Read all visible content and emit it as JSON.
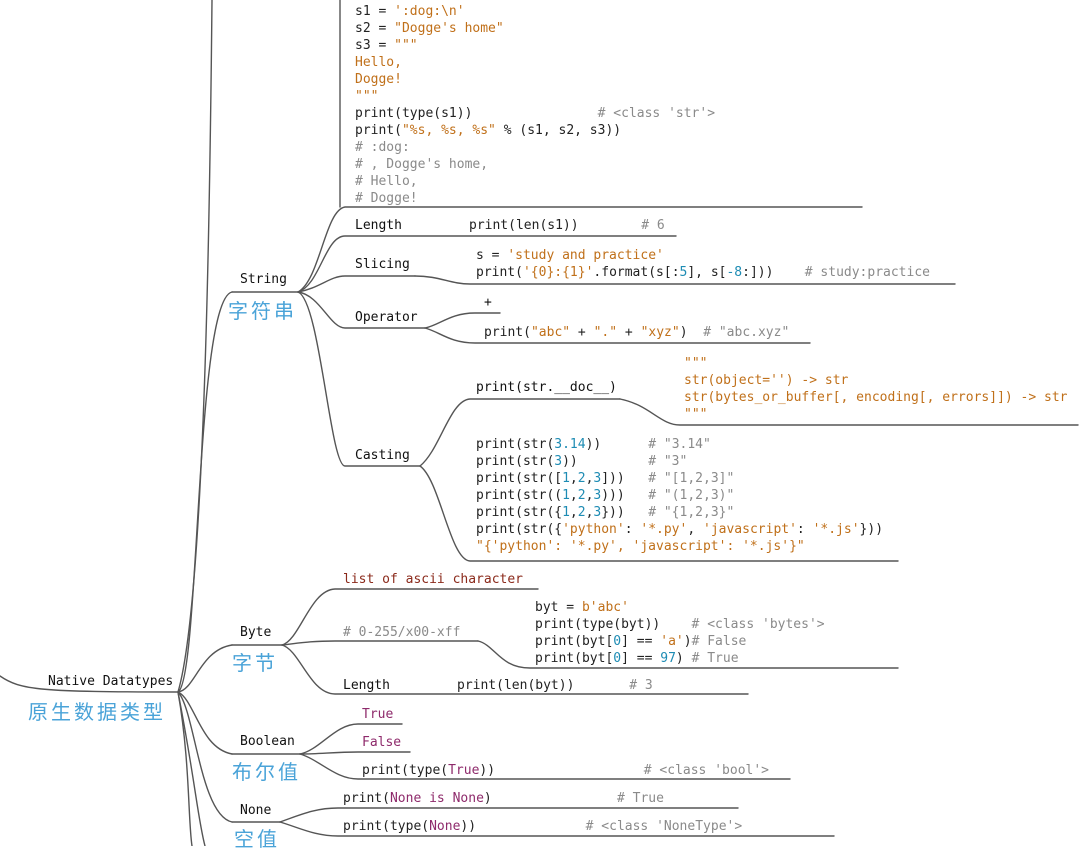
{
  "root": {
    "label": "Native Datatypes",
    "label_cn": "原生数据类型"
  },
  "string": {
    "label": "String",
    "label_cn": "字符串",
    "code": [
      [
        [
          "s1 = ",
          ""
        ],
        [
          "':dog:\\n'",
          "s"
        ]
      ],
      [
        [
          "s2 = ",
          ""
        ],
        [
          "\"Dogge's home\"",
          "s"
        ]
      ],
      [
        [
          "s3 = ",
          ""
        ],
        [
          "\"\"\"",
          "s"
        ]
      ],
      [
        [
          "Hello,",
          "s"
        ]
      ],
      [
        [
          "Dogge!",
          "s"
        ]
      ],
      [
        [
          "\"\"\"",
          "s"
        ]
      ],
      [
        [
          "print(type(s1))                ",
          ""
        ],
        [
          "# <class 'str'>",
          "c"
        ]
      ],
      [
        [
          "print(",
          ""
        ],
        [
          "\"%s, %s, %s\"",
          "s"
        ],
        [
          " % (s1, s2, s3))",
          ""
        ]
      ],
      [
        [
          "# :dog:",
          "c"
        ]
      ],
      [
        [
          "# , Dogge's home,",
          "c"
        ]
      ],
      [
        [
          "# Hello,",
          "c"
        ]
      ],
      [
        [
          "# Dogge!",
          "c"
        ]
      ]
    ],
    "length": {
      "label": "Length",
      "code": [
        [
          [
            "print(len(s1))",
            ""
          ],
          [
            "        # 6",
            "c"
          ]
        ]
      ]
    },
    "slicing": {
      "label": "Slicing",
      "code": [
        [
          [
            "s = ",
            ""
          ],
          [
            "'study and practice'",
            "s"
          ]
        ],
        [
          [
            "print(",
            ""
          ],
          [
            "'{0}:{1}'",
            "s"
          ],
          [
            ".format(s[:",
            ""
          ],
          [
            "5",
            "n"
          ],
          [
            "], s[",
            ""
          ],
          [
            "-8",
            "n"
          ],
          [
            ":]))",
            ""
          ],
          [
            "    # study:practice",
            "c"
          ]
        ]
      ]
    },
    "operator": {
      "label": "Operator",
      "plus": "+",
      "code": [
        [
          [
            "print(",
            ""
          ],
          [
            "\"abc\"",
            "s"
          ],
          [
            " + ",
            ""
          ],
          [
            "\".\"",
            "s"
          ],
          [
            " + ",
            ""
          ],
          [
            "\"xyz\"",
            "s"
          ],
          [
            ")  ",
            ""
          ],
          [
            "# \"abc.xyz\"",
            "c"
          ]
        ]
      ]
    },
    "casting": {
      "label": "Casting",
      "doc_call": "print(str.__doc__)",
      "doc": [
        [
          [
            "\"\"\"",
            "s"
          ]
        ],
        [
          [
            "str(object='') -> str",
            "s"
          ]
        ],
        [
          [
            "str(bytes_or_buffer[, encoding[, errors]]) -> str",
            "s"
          ]
        ],
        [
          [
            "\"\"\"",
            "s"
          ]
        ]
      ],
      "code": [
        [
          [
            "print(str(",
            ""
          ],
          [
            "3.14",
            "n"
          ],
          [
            "))      ",
            ""
          ],
          [
            "# \"3.14\"",
            "c"
          ]
        ],
        [
          [
            "print(str(",
            ""
          ],
          [
            "3",
            "n"
          ],
          [
            "))         ",
            ""
          ],
          [
            "# \"3\"",
            "c"
          ]
        ],
        [
          [
            "print(str([",
            ""
          ],
          [
            "1",
            "n"
          ],
          [
            ",",
            ""
          ],
          [
            "2",
            "n"
          ],
          [
            ",",
            ""
          ],
          [
            "3",
            "n"
          ],
          [
            "]))   ",
            ""
          ],
          [
            "# \"[1,2,3]\"",
            "c"
          ]
        ],
        [
          [
            "print(str((",
            ""
          ],
          [
            "1",
            "n"
          ],
          [
            ",",
            ""
          ],
          [
            "2",
            "n"
          ],
          [
            ",",
            ""
          ],
          [
            "3",
            "n"
          ],
          [
            ")))   ",
            ""
          ],
          [
            "# \"(1,2,3)\"",
            "c"
          ]
        ],
        [
          [
            "print(str({",
            ""
          ],
          [
            "1",
            "n"
          ],
          [
            ",",
            ""
          ],
          [
            "2",
            "n"
          ],
          [
            ",",
            ""
          ],
          [
            "3",
            "n"
          ],
          [
            "}))   ",
            ""
          ],
          [
            "# \"{1,2,3}\"",
            "c"
          ]
        ],
        [
          [
            "print(str({",
            ""
          ],
          [
            "'python'",
            "s"
          ],
          [
            ": ",
            ""
          ],
          [
            "'*.py'",
            "s"
          ],
          [
            ", ",
            ""
          ],
          [
            "'javascript'",
            "s"
          ],
          [
            ": ",
            ""
          ],
          [
            "'*.js'",
            "s"
          ],
          [
            "}))",
            ""
          ]
        ],
        [
          [
            "\"{'python': '*.py', 'javascript': '*.js'}\"",
            "s"
          ]
        ]
      ]
    }
  },
  "byte": {
    "label": "Byte",
    "label_cn": "字节",
    "ascii": "list of ascii character",
    "range_comment": "# 0-255/x00-xff",
    "code": [
      [
        [
          "byt = ",
          ""
        ],
        [
          "b'abc'",
          "s"
        ]
      ],
      [
        [
          "print(type(byt))    ",
          ""
        ],
        [
          "# <class 'bytes'>",
          "c"
        ]
      ],
      [
        [
          "print(byt[",
          ""
        ],
        [
          "0",
          "n"
        ],
        [
          "] == ",
          ""
        ],
        [
          "'a'",
          "s"
        ],
        [
          ")",
          ""
        ],
        [
          "# False",
          "c"
        ]
      ],
      [
        [
          "print(byt[",
          ""
        ],
        [
          "0",
          "n"
        ],
        [
          "] == ",
          ""
        ],
        [
          "97",
          "n"
        ],
        [
          ") ",
          ""
        ],
        [
          "# True",
          "c"
        ]
      ]
    ],
    "length": {
      "label": "Length",
      "code": [
        [
          [
            "print(len(byt))",
            ""
          ],
          [
            "       # 3",
            "c"
          ]
        ]
      ]
    }
  },
  "boolean": {
    "label": "Boolean",
    "label_cn": "布尔值",
    "true": "True",
    "false": "False",
    "code": [
      [
        [
          "print(type(",
          ""
        ],
        [
          "True",
          "k"
        ],
        [
          "))",
          ""
        ],
        [
          "                   # <class 'bool'>",
          "c"
        ]
      ]
    ]
  },
  "none": {
    "label": "None",
    "label_cn": "空值",
    "code1": [
      [
        [
          "print(",
          ""
        ],
        [
          "None",
          "k"
        ],
        [
          " ",
          ""
        ],
        [
          "is",
          "k"
        ],
        [
          " ",
          ""
        ],
        [
          "None",
          "k"
        ],
        [
          ")",
          ""
        ],
        [
          "                # True",
          "c"
        ]
      ]
    ],
    "code2": [
      [
        [
          "print(type(",
          ""
        ],
        [
          "None",
          "k"
        ],
        [
          "))",
          ""
        ],
        [
          "              # <class 'NoneType'>",
          "c"
        ]
      ]
    ]
  }
}
